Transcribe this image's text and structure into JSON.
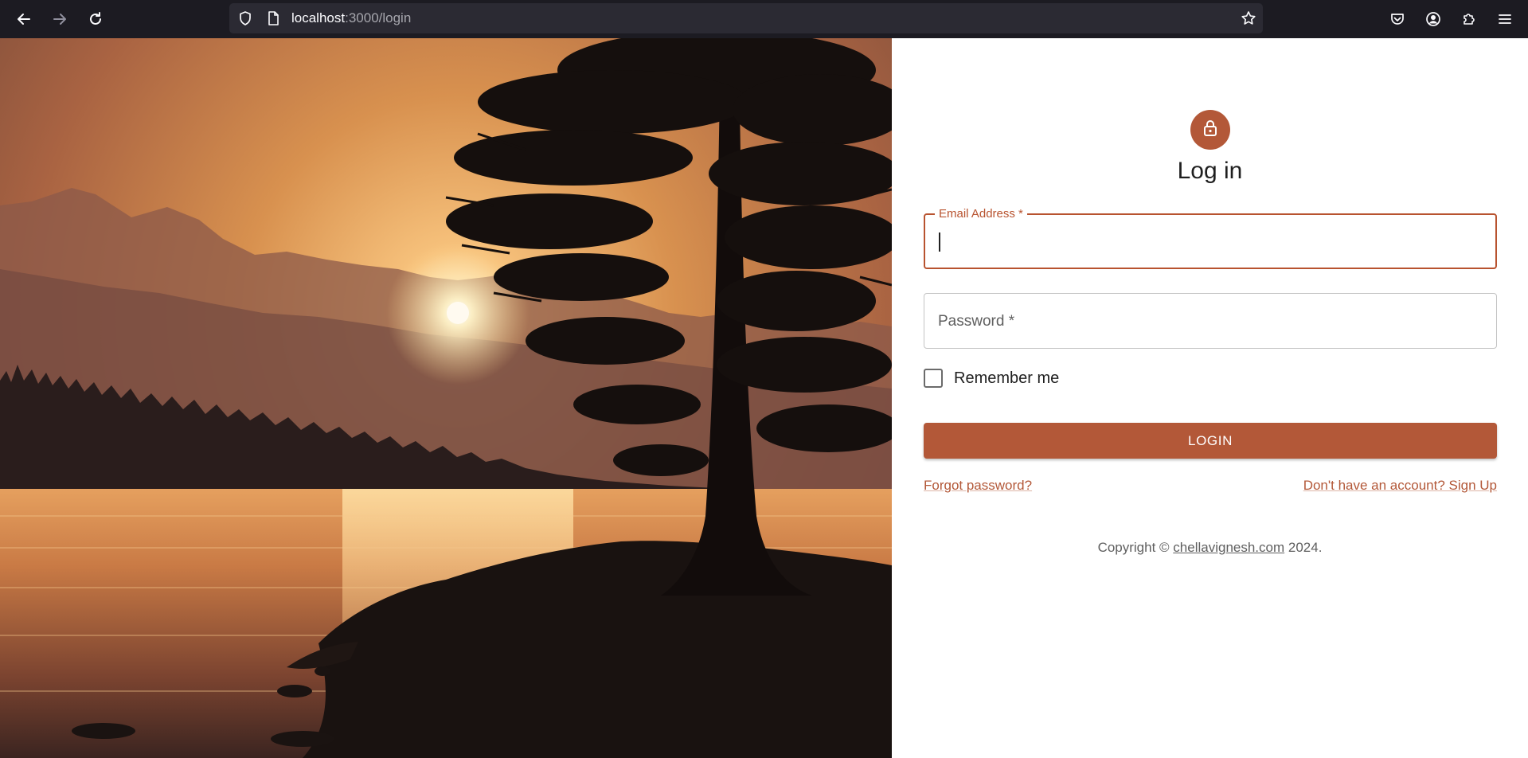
{
  "browser": {
    "url_host": "localhost",
    "url_path": ":3000/login"
  },
  "login": {
    "title": "Log in",
    "email_label": "Email Address *",
    "email_value": "",
    "password_label": "Password *",
    "password_value": "",
    "remember_label": "Remember me",
    "remember_checked": false,
    "button_label": "LOGIN",
    "forgot_link": "Forgot password?",
    "signup_link": "Don't have an account? Sign Up"
  },
  "footer": {
    "copyright_prefix": "Copyright © ",
    "site": "chellavignesh.com",
    "copyright_suffix": " 2024."
  },
  "colors": {
    "accent": "#b35838",
    "chrome_bg": "#1c1b22",
    "urlbar_bg": "#2b2a33"
  },
  "icons": [
    "back-arrow-icon",
    "forward-arrow-icon",
    "reload-icon",
    "shield-icon",
    "page-icon",
    "star-icon",
    "pocket-icon",
    "account-icon",
    "extensions-icon",
    "menu-icon",
    "lock-icon"
  ]
}
